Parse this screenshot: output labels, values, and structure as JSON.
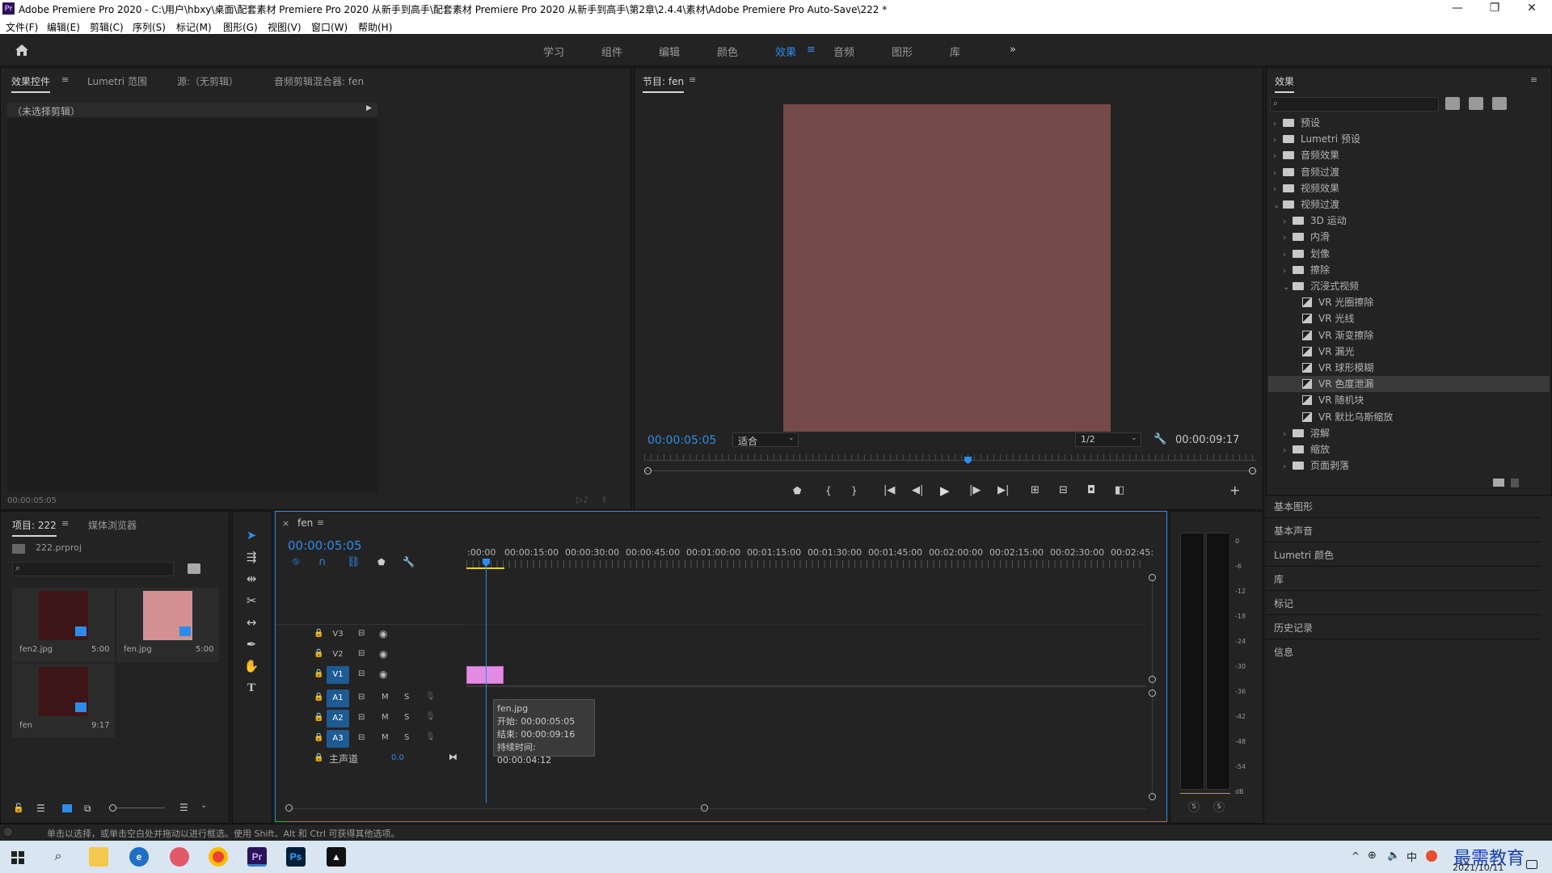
{
  "window": {
    "app_icon": "Pr",
    "title": "Adobe Premiere Pro 2020 - C:\\用户\\hbxy\\桌面\\配套素材 Premiere Pro 2020 从新手到高手\\配套素材 Premiere Pro 2020 从新手到高手\\第2章\\2.4.4\\素材\\Adobe Premiere Pro Auto-Save\\222 *",
    "minimize": "—",
    "maximize": "❐",
    "close": "✕"
  },
  "menu": [
    "文件(F)",
    "编辑(E)",
    "剪辑(C)",
    "序列(S)",
    "标记(M)",
    "图形(G)",
    "视图(V)",
    "窗口(W)",
    "帮助(H)"
  ],
  "workspaces": {
    "home_icon": "home-icon",
    "items": [
      "学习",
      "组件",
      "编辑",
      "颜色",
      "效果",
      "音频",
      "图形",
      "库"
    ],
    "active": "效果",
    "more": "»",
    "menu_glyph": "≡"
  },
  "source_panel": {
    "tabs": [
      "效果控件",
      "Lumetri 范围",
      "源:（无剪辑）",
      "音频剪辑混合器: fen"
    ],
    "menu_glyph": "≡",
    "no_clip": "（未选择剪辑）",
    "timecode": "00:00:05:05"
  },
  "program_monitor": {
    "title": "节目: fen",
    "menu_glyph": "≡",
    "frame_color": "#744a4a",
    "current_time": "00:00:05:05",
    "fit_label": "适合",
    "resolution": "1/2",
    "duration": "00:00:09:17"
  },
  "effects_panel": {
    "title": "效果",
    "menu_glyph": "≡",
    "search_placeholder": "",
    "tree": [
      {
        "label": "预设",
        "level": 0,
        "type": "folder",
        "open": false
      },
      {
        "label": "Lumetri 预设",
        "level": 0,
        "type": "folder",
        "open": false
      },
      {
        "label": "音频效果",
        "level": 0,
        "type": "folder",
        "open": false
      },
      {
        "label": "音频过渡",
        "level": 0,
        "type": "folder",
        "open": false
      },
      {
        "label": "视频效果",
        "level": 0,
        "type": "folder",
        "open": false
      },
      {
        "label": "视频过渡",
        "level": 0,
        "type": "folder",
        "open": true
      },
      {
        "label": "3D 运动",
        "level": 1,
        "type": "folder",
        "open": false
      },
      {
        "label": "内滑",
        "level": 1,
        "type": "folder",
        "open": false
      },
      {
        "label": "划像",
        "level": 1,
        "type": "folder",
        "open": false
      },
      {
        "label": "擦除",
        "level": 1,
        "type": "folder",
        "open": false
      },
      {
        "label": "沉浸式视频",
        "level": 1,
        "type": "folder",
        "open": true
      },
      {
        "label": "VR 光圈擦除",
        "level": 2,
        "type": "effect"
      },
      {
        "label": "VR 光线",
        "level": 2,
        "type": "effect"
      },
      {
        "label": "VR 渐变擦除",
        "level": 2,
        "type": "effect"
      },
      {
        "label": "VR 漏光",
        "level": 2,
        "type": "effect"
      },
      {
        "label": "VR 球形模糊",
        "level": 2,
        "type": "effect"
      },
      {
        "label": "VR 色度泄漏",
        "level": 2,
        "type": "effect",
        "selected": true
      },
      {
        "label": "VR 随机块",
        "level": 2,
        "type": "effect"
      },
      {
        "label": "VR 默比乌斯缩放",
        "level": 2,
        "type": "effect"
      },
      {
        "label": "溶解",
        "level": 1,
        "type": "folder",
        "open": false
      },
      {
        "label": "缩放",
        "level": 1,
        "type": "folder",
        "open": false
      },
      {
        "label": "页面剥落",
        "level": 1,
        "type": "folder",
        "open": false
      }
    ]
  },
  "side_panels": [
    "基本图形",
    "基本声音",
    "Lumetri 颜色",
    "库",
    "标记",
    "历史记录",
    "信息"
  ],
  "project_panel": {
    "tabs": [
      "项目: 222",
      "媒体浏览器"
    ],
    "menu_glyph": "≡",
    "project_file": "222.prproj",
    "items": [
      {
        "name": "fen2.jpg",
        "duration": "5:00",
        "color": "#3d1518"
      },
      {
        "name": "fen.jpg",
        "duration": "5:00",
        "color": "#d49090"
      },
      {
        "name": "fen",
        "duration": "9:17",
        "color": "#3d1518"
      }
    ]
  },
  "timeline": {
    "close": "×",
    "sequence": "fen",
    "menu_glyph": "≡",
    "timecode": "00:00:05:05",
    "ruler": [
      ":00:00",
      "00:00:15:00",
      "00:00:30:00",
      "00:00:45:00",
      "00:01:00:00",
      "00:01:15:00",
      "00:01:30:00",
      "00:01:45:00",
      "00:02:00:00",
      "00:02:15:00",
      "00:02:30:00",
      "00:02:45:"
    ],
    "video_tracks": [
      "V3",
      "V2",
      "V1"
    ],
    "audio_tracks": [
      "A1",
      "A2",
      "A3"
    ],
    "mute": "M",
    "solo": "S",
    "master_label": "主声道",
    "master_value": "0.0",
    "clip_color": "#e38be3",
    "tooltip": {
      "name": "fen.jpg",
      "start": "开始: 00:00:05:05",
      "end": "结束: 00:00:09:16",
      "duration": "持续时间: 00:00:04:12"
    }
  },
  "meter": {
    "scale": [
      "0",
      "-6",
      "-12",
      "-18",
      "-24",
      "-30",
      "-36",
      "-42",
      "-48",
      "-54",
      "dB"
    ],
    "solo_left": "S",
    "solo_right": "S"
  },
  "status_bar": {
    "text": "单击以选择，或单击空白处并拖动以进行框选。使用 Shift、Alt 和 Ctrl 可获得其他选项。"
  },
  "taskbar": {
    "date": "2021/10/11",
    "watermark": "最需教育",
    "ime": "中"
  }
}
